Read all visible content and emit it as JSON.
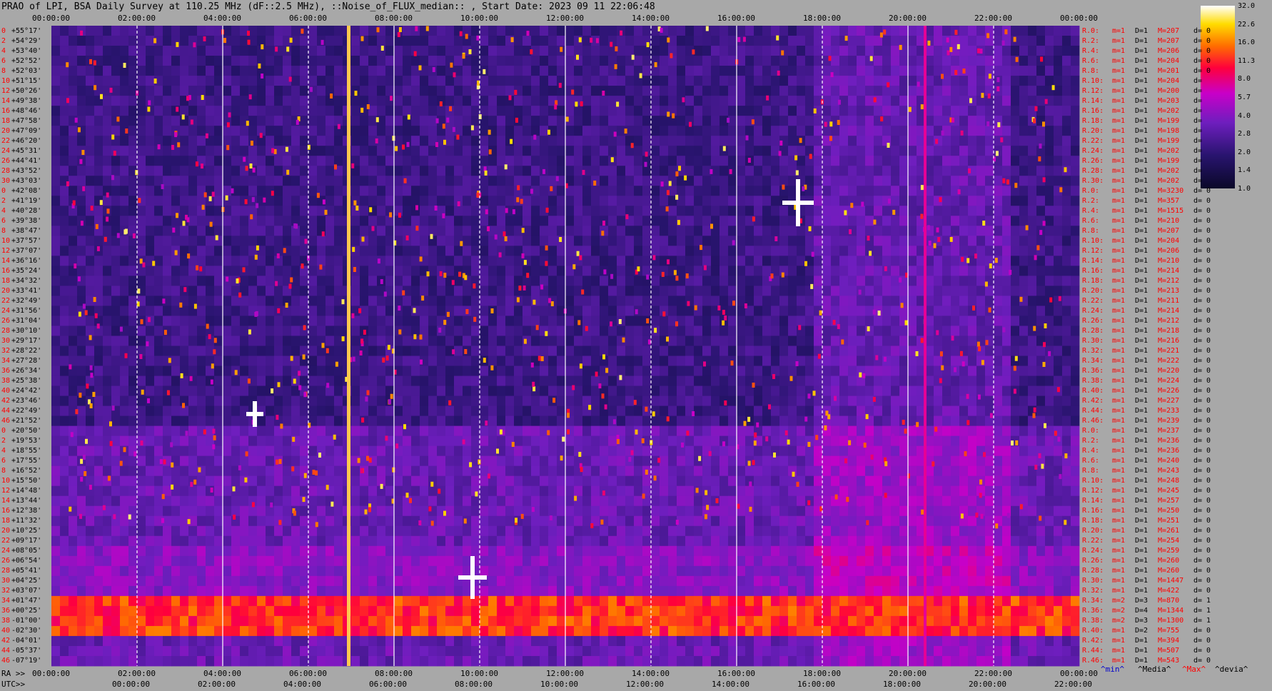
{
  "title": "PRAO of LPI, BSA Daily Survey at 110.25 MHz (dF::2.5 MHz), ::Noise_of_FLUX_median:: , Start Date: 2023 09 11 22:06:48",
  "colors": {
    "page_bg": "#a8a8a8",
    "plot_bg": "#0a0828",
    "row_label": "#ff0000",
    "stats_small": "#ff0000",
    "stats_value": "#000000",
    "footer_min": "#0000cc",
    "footer_media": "#000000",
    "footer_max": "#ff0000",
    "footer_devia": "#000000"
  },
  "top_axis_ticks": [
    "00:00:00",
    "02:00:00",
    "04:00:00",
    "06:00:00",
    "08:00:00",
    "10:00:00",
    "12:00:00",
    "14:00:00",
    "16:00:00",
    "18:00:00",
    "20:00:00",
    "22:00:00",
    "00:00:00"
  ],
  "bottom_ra_prefix": "RA >>",
  "bottom_ra_ticks": [
    "00:00:00",
    "02:00:00",
    "04:00:00",
    "06:00:00",
    "08:00:00",
    "10:00:00",
    "12:00:00",
    "14:00:00",
    "16:00:00",
    "18:00:00",
    "20:00:00",
    "22:00:00",
    "00:00:00"
  ],
  "bottom_utc_prefix": "UTC>>",
  "bottom_utc_ticks": [
    "00:00:00",
    "02:00:00",
    "04:00:00",
    "06:00:00",
    "08:00:00",
    "10:00:00",
    "12:00:00",
    "14:00:00",
    "16:00:00",
    "18:00:00",
    "20:00:00",
    "22:00:00"
  ],
  "footer_legend": {
    "min": "^min^",
    "media": "^Media^",
    "max": "^Max^",
    "devia": "^devia^"
  },
  "colorbar": {
    "ticks": [
      "32.0",
      "22.6",
      "16.0",
      "11.3",
      "8.0",
      "5.7",
      "4.0",
      "2.8",
      "2.0",
      "1.4",
      "1.0"
    ]
  },
  "chart_data": {
    "type": "heatmap",
    "title": "PRAO of LPI, BSA Daily Survey at 110.25 MHz (dF::2.5 MHz), ::Noise_of_FLUX_median:: , Start Date: 2023 09 11 22:06:48",
    "x_axis_top_label": "RA",
    "x_axis_bottom_labels": [
      "RA >>",
      "UTC>>"
    ],
    "y_tick_labels": [
      "+55°17'",
      "+54°29'",
      "+53°40'",
      "+52°52'",
      "+52°03'",
      "+51°15'",
      "+50°26'",
      "+49°38'",
      "+48°46'",
      "+47°58'",
      "+47°09'",
      "+46°20'",
      "+45°31'",
      "+44°41'",
      "+43°52'",
      "+43°03'",
      "+42°08'",
      "+41°19'",
      "+40°28'",
      "+39°38'",
      "+38°47'",
      "+37°57'",
      "+37°07'",
      "+36°16'",
      "+35°24'",
      "+34°32'",
      "+33°41'",
      "+32°49'",
      "+31°56'",
      "+31°04'",
      "+30°10'",
      "+29°17'",
      "+28°22'",
      "+27°28'",
      "+26°34'",
      "+25°38'",
      "+24°42'",
      "+23°46'",
      "+22°49'",
      "+21°52'",
      "+20°50'",
      "+19°53'",
      "+18°55'",
      "+17°55'",
      "+16°52'",
      "+15°50'",
      "+14°48'",
      "+13°44'",
      "+12°38'",
      "+11°32'",
      "+10°25'",
      "+09°17'",
      "+08°05'",
      "+06°54'",
      "+05°41'",
      "+04°25'",
      "+03°07'",
      "+01°47'",
      "+00°25'",
      "-01°00'",
      "-02°30'",
      "-04°01'",
      "-05°37'",
      "-07°19'"
    ],
    "row_index_labels": [
      "0",
      "2",
      "4",
      "6",
      "8",
      "10",
      "12",
      "14",
      "16",
      "18",
      "20",
      "22",
      "24",
      "26",
      "28",
      "30",
      "0",
      "2",
      "4",
      "6",
      "8",
      "10",
      "12",
      "14",
      "16",
      "18",
      "20",
      "22",
      "24",
      "26",
      "28",
      "30",
      "32",
      "34",
      "36",
      "38",
      "40",
      "42",
      "44",
      "46",
      "0",
      "2",
      "4",
      "6",
      "8",
      "10",
      "12",
      "14",
      "16",
      "18",
      "20",
      "22",
      "24",
      "26",
      "28",
      "30",
      "32",
      "34",
      "36",
      "38",
      "40",
      "42",
      "44",
      "46"
    ],
    "colorbar_ticks": [
      32.0,
      22.6,
      16.0,
      11.3,
      8.0,
      5.7,
      4.0,
      2.8,
      2.0,
      1.4,
      1.0
    ],
    "colorbar_range": [
      1.0,
      32.0
    ],
    "colorbar_scale": "log",
    "row_stats": [
      {
        "r": "R.0:",
        "m": "m=1",
        "d": "D=1",
        "M": "M=207",
        "dv": "d= 0"
      },
      {
        "r": "R.2:",
        "m": "m=1",
        "d": "D=1",
        "M": "M=207",
        "dv": "d= 0"
      },
      {
        "r": "R.4:",
        "m": "m=1",
        "d": "D=1",
        "M": "M=206",
        "dv": "d= 0"
      },
      {
        "r": "R.6:",
        "m": "m=1",
        "d": "D=1",
        "M": "M=204",
        "dv": "d= 0"
      },
      {
        "r": "R.8:",
        "m": "m=1",
        "d": "D=1",
        "M": "M=201",
        "dv": "d= 0"
      },
      {
        "r": "R.10:",
        "m": "m=1",
        "d": "D=1",
        "M": "M=204",
        "dv": "d="
      },
      {
        "r": "R.12:",
        "m": "m=1",
        "d": "D=1",
        "M": "M=200",
        "dv": "d="
      },
      {
        "r": "R.14:",
        "m": "m=1",
        "d": "D=1",
        "M": "M=203",
        "dv": "d="
      },
      {
        "r": "R.16:",
        "m": "m=1",
        "d": "D=1",
        "M": "M=202",
        "dv": "d="
      },
      {
        "r": "R.18:",
        "m": "m=1",
        "d": "D=1",
        "M": "M=199",
        "dv": "d="
      },
      {
        "r": "R.20:",
        "m": "m=1",
        "d": "D=1",
        "M": "M=198",
        "dv": "d="
      },
      {
        "r": "R.22:",
        "m": "m=1",
        "d": "D=1",
        "M": "M=199",
        "dv": "d="
      },
      {
        "r": "R.24:",
        "m": "m=1",
        "d": "D=1",
        "M": "M=202",
        "dv": "d="
      },
      {
        "r": "R.26:",
        "m": "m=1",
        "d": "D=1",
        "M": "M=199",
        "dv": "d="
      },
      {
        "r": "R.28:",
        "m": "m=1",
        "d": "D=1",
        "M": "M=202",
        "dv": "d="
      },
      {
        "r": "R.30:",
        "m": "m=1",
        "d": "D=1",
        "M": "M=202",
        "dv": "d="
      },
      {
        "r": "R.0:",
        "m": "m=1",
        "d": "D=1",
        "M": "M=3230",
        "dv": "d= 0"
      },
      {
        "r": "R.2:",
        "m": "m=1",
        "d": "D=1",
        "M": "M=357",
        "dv": "d= 0"
      },
      {
        "r": "R.4:",
        "m": "m=1",
        "d": "D=1",
        "M": "M=1515",
        "dv": "d= 0"
      },
      {
        "r": "R.6:",
        "m": "m=1",
        "d": "D=1",
        "M": "M=210",
        "dv": "d= 0"
      },
      {
        "r": "R.8:",
        "m": "m=1",
        "d": "D=1",
        "M": "M=207",
        "dv": "d= 0"
      },
      {
        "r": "R.10:",
        "m": "m=1",
        "d": "D=1",
        "M": "M=204",
        "dv": "d= 0"
      },
      {
        "r": "R.12:",
        "m": "m=1",
        "d": "D=1",
        "M": "M=206",
        "dv": "d= 0"
      },
      {
        "r": "R.14:",
        "m": "m=1",
        "d": "D=1",
        "M": "M=210",
        "dv": "d= 0"
      },
      {
        "r": "R.16:",
        "m": "m=1",
        "d": "D=1",
        "M": "M=214",
        "dv": "d= 0"
      },
      {
        "r": "R.18:",
        "m": "m=1",
        "d": "D=1",
        "M": "M=212",
        "dv": "d= 0"
      },
      {
        "r": "R.20:",
        "m": "m=1",
        "d": "D=1",
        "M": "M=213",
        "dv": "d= 0"
      },
      {
        "r": "R.22:",
        "m": "m=1",
        "d": "D=1",
        "M": "M=211",
        "dv": "d= 0"
      },
      {
        "r": "R.24:",
        "m": "m=1",
        "d": "D=1",
        "M": "M=214",
        "dv": "d= 0"
      },
      {
        "r": "R.26:",
        "m": "m=1",
        "d": "D=1",
        "M": "M=212",
        "dv": "d= 0"
      },
      {
        "r": "R.28:",
        "m": "m=1",
        "d": "D=1",
        "M": "M=218",
        "dv": "d= 0"
      },
      {
        "r": "R.30:",
        "m": "m=1",
        "d": "D=1",
        "M": "M=216",
        "dv": "d= 0"
      },
      {
        "r": "R.32:",
        "m": "m=1",
        "d": "D=1",
        "M": "M=221",
        "dv": "d= 0"
      },
      {
        "r": "R.34:",
        "m": "m=1",
        "d": "D=1",
        "M": "M=222",
        "dv": "d= 0"
      },
      {
        "r": "R.36:",
        "m": "m=1",
        "d": "D=1",
        "M": "M=220",
        "dv": "d= 0"
      },
      {
        "r": "R.38:",
        "m": "m=1",
        "d": "D=1",
        "M": "M=224",
        "dv": "d= 0"
      },
      {
        "r": "R.40:",
        "m": "m=1",
        "d": "D=1",
        "M": "M=226",
        "dv": "d= 0"
      },
      {
        "r": "R.42:",
        "m": "m=1",
        "d": "D=1",
        "M": "M=227",
        "dv": "d= 0"
      },
      {
        "r": "R.44:",
        "m": "m=1",
        "d": "D=1",
        "M": "M=233",
        "dv": "d= 0"
      },
      {
        "r": "R.46:",
        "m": "m=1",
        "d": "D=1",
        "M": "M=239",
        "dv": "d= 0"
      },
      {
        "r": "R.0:",
        "m": "m=1",
        "d": "D=1",
        "M": "M=237",
        "dv": "d= 0"
      },
      {
        "r": "R.2:",
        "m": "m=1",
        "d": "D=1",
        "M": "M=236",
        "dv": "d= 0"
      },
      {
        "r": "R.4:",
        "m": "m=1",
        "d": "D=1",
        "M": "M=236",
        "dv": "d= 0"
      },
      {
        "r": "R.6:",
        "m": "m=1",
        "d": "D=1",
        "M": "M=240",
        "dv": "d= 0"
      },
      {
        "r": "R.8:",
        "m": "m=1",
        "d": "D=1",
        "M": "M=243",
        "dv": "d= 0"
      },
      {
        "r": "R.10:",
        "m": "m=1",
        "d": "D=1",
        "M": "M=248",
        "dv": "d= 0"
      },
      {
        "r": "R.12:",
        "m": "m=1",
        "d": "D=1",
        "M": "M=245",
        "dv": "d= 0"
      },
      {
        "r": "R.14:",
        "m": "m=1",
        "d": "D=1",
        "M": "M=257",
        "dv": "d= 0"
      },
      {
        "r": "R.16:",
        "m": "m=1",
        "d": "D=1",
        "M": "M=250",
        "dv": "d= 0"
      },
      {
        "r": "R.18:",
        "m": "m=1",
        "d": "D=1",
        "M": "M=251",
        "dv": "d= 0"
      },
      {
        "r": "R.20:",
        "m": "m=1",
        "d": "D=1",
        "M": "M=261",
        "dv": "d= 0"
      },
      {
        "r": "R.22:",
        "m": "m=1",
        "d": "D=1",
        "M": "M=254",
        "dv": "d= 0"
      },
      {
        "r": "R.24:",
        "m": "m=1",
        "d": "D=1",
        "M": "M=259",
        "dv": "d= 0"
      },
      {
        "r": "R.26:",
        "m": "m=1",
        "d": "D=1",
        "M": "M=260",
        "dv": "d= 0"
      },
      {
        "r": "R.28:",
        "m": "m=1",
        "d": "D=1",
        "M": "M=260",
        "dv": "d= 0"
      },
      {
        "r": "R.30:",
        "m": "m=1",
        "d": "D=1",
        "M": "M=1447",
        "dv": "d= 0"
      },
      {
        "r": "R.32:",
        "m": "m=1",
        "d": "D=1",
        "M": "M=422",
        "dv": "d= 0"
      },
      {
        "r": "R.34:",
        "m": "m=2",
        "d": "D=3",
        "M": "M=870",
        "dv": "d= 1"
      },
      {
        "r": "R.36:",
        "m": "m=2",
        "d": "D=4",
        "M": "M=1344",
        "dv": "d= 1"
      },
      {
        "r": "R.38:",
        "m": "m=2",
        "d": "D=3",
        "M": "M=1300",
        "dv": "d= 1"
      },
      {
        "r": "R.40:",
        "m": "m=1",
        "d": "D=2",
        "M": "M=755",
        "dv": "d= 0"
      },
      {
        "r": "R.42:",
        "m": "m=1",
        "d": "D=1",
        "M": "M=394",
        "dv": "d= 0"
      },
      {
        "r": "R.44:",
        "m": "m=1",
        "d": "D=1",
        "M": "M=507",
        "dv": "d= 0"
      },
      {
        "r": "R.46:",
        "m": "m=1",
        "d": "D=1",
        "M": "M=543",
        "dv": "d= 0"
      }
    ]
  }
}
